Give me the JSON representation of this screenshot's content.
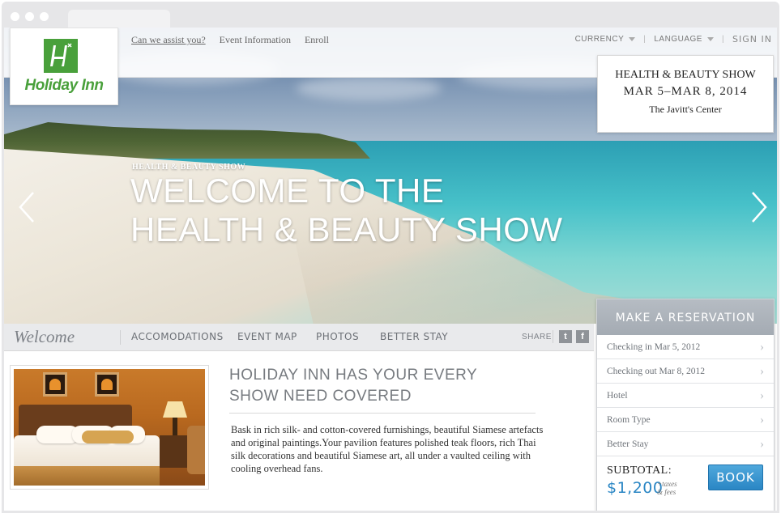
{
  "header": {
    "logo_text": "Holiday Inn",
    "links": [
      "Can we assist you?",
      "Event Information",
      "Enroll"
    ],
    "currency_label": "CURRENCY",
    "language_label": "LANGUAGE",
    "sign_in_label": "SIGN IN"
  },
  "event": {
    "name": "HEALTH & BEAUTY SHOW",
    "dates": "MAR 5–MAR 8, 2014",
    "venue": "The Javitt's Center"
  },
  "hero": {
    "kicker": "HEALTH & BEAUTY SHOW",
    "title_line1": "WELCOME TO THE",
    "title_line2": "HEALTH & BEAUTY SHOW"
  },
  "subnav": {
    "welcome": "Welcome",
    "items": [
      "ACCOMODATIONS",
      "EVENT MAP",
      "PHOTOS",
      "BETTER STAY"
    ],
    "share_label": "SHARE",
    "social": [
      "t",
      "f"
    ]
  },
  "content": {
    "title_line1": "HOLIDAY INN HAS YOUR EVERY",
    "title_line2": "SHOW NEED COVERED",
    "body": "Bask in rich silk- and cotton-covered furnishings, beautiful Siamese artefacts and original paintings.Your pavilion features polished teak floors, rich Thai silk decorations and beautiful Siamese art, all under a vaulted ceiling with cooling overhead fans."
  },
  "reservation": {
    "title": "MAKE A RESERVATION",
    "rows": [
      "Checking in Mar 5, 2012",
      "Checking out Mar 8, 2012",
      "Hotel",
      "Room Type",
      "Better Stay"
    ],
    "subtotal_label": "SUBTOTAL:",
    "subtotal_value": "$1,200",
    "fees_line1": "+taxes",
    "fees_line2": "& fees",
    "book_label": "BOOK"
  },
  "colors": {
    "brand_green": "#49a03b",
    "accent_blue": "#2a86c4"
  }
}
